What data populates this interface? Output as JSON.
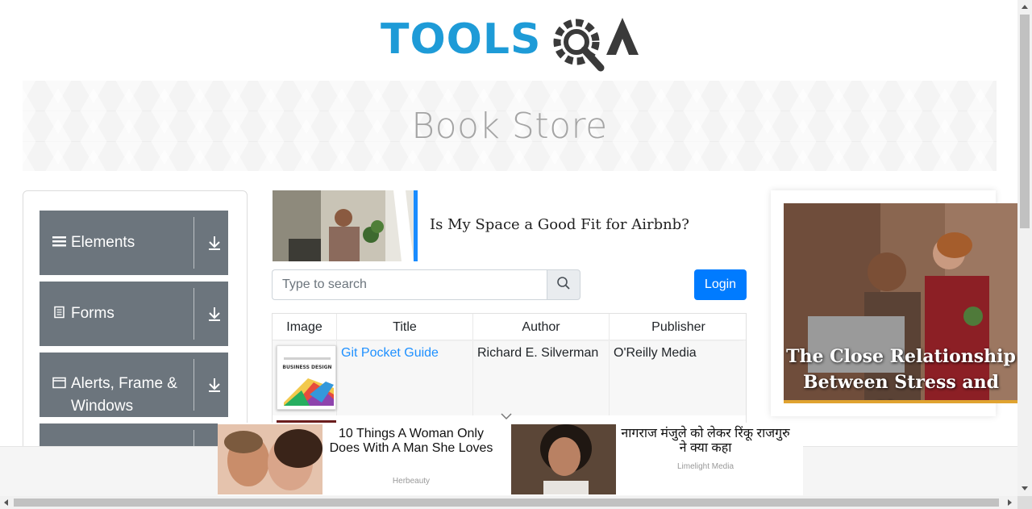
{
  "logo": {
    "text": "TOOLSQA"
  },
  "banner": {
    "title": "Book Store"
  },
  "sidebar": {
    "groups": [
      {
        "label": "Elements",
        "icon": "hamburger-icon"
      },
      {
        "label": "Forms",
        "icon": "form-icon"
      },
      {
        "label": "Alerts, Frame & Windows",
        "icon": "window-icon"
      }
    ]
  },
  "top_ad": {
    "headline": "Is My Space a Good Fit for Airbnb?"
  },
  "search": {
    "placeholder": "Type to search",
    "value": ""
  },
  "login": {
    "label": "Login"
  },
  "table": {
    "headers": [
      "Image",
      "Title",
      "Author",
      "Publisher"
    ],
    "rows": [
      {
        "title": "Git Pocket Guide",
        "author": "Richard E. Silverman",
        "publisher": "O'Reilly Media",
        "cover_text": "BUSINESS DESIGN"
      }
    ]
  },
  "right_ad": {
    "headline": "The Close Relationship Between Stress and Sleep"
  },
  "bottom_ads": [
    {
      "title": "10 Things A Woman Only Does With A Man She Loves",
      "source": "Herbeauty"
    },
    {
      "title": "नागराज मंजुले को लेकर रिंकू राजगुरु ने क्या कहा",
      "source": "Limelight Media"
    }
  ],
  "colors": {
    "sidebar_bg": "#6c757d",
    "accent_blue": "#007bff",
    "logo_blue": "#1e9bd7",
    "logo_dark": "#3a3a3a"
  }
}
